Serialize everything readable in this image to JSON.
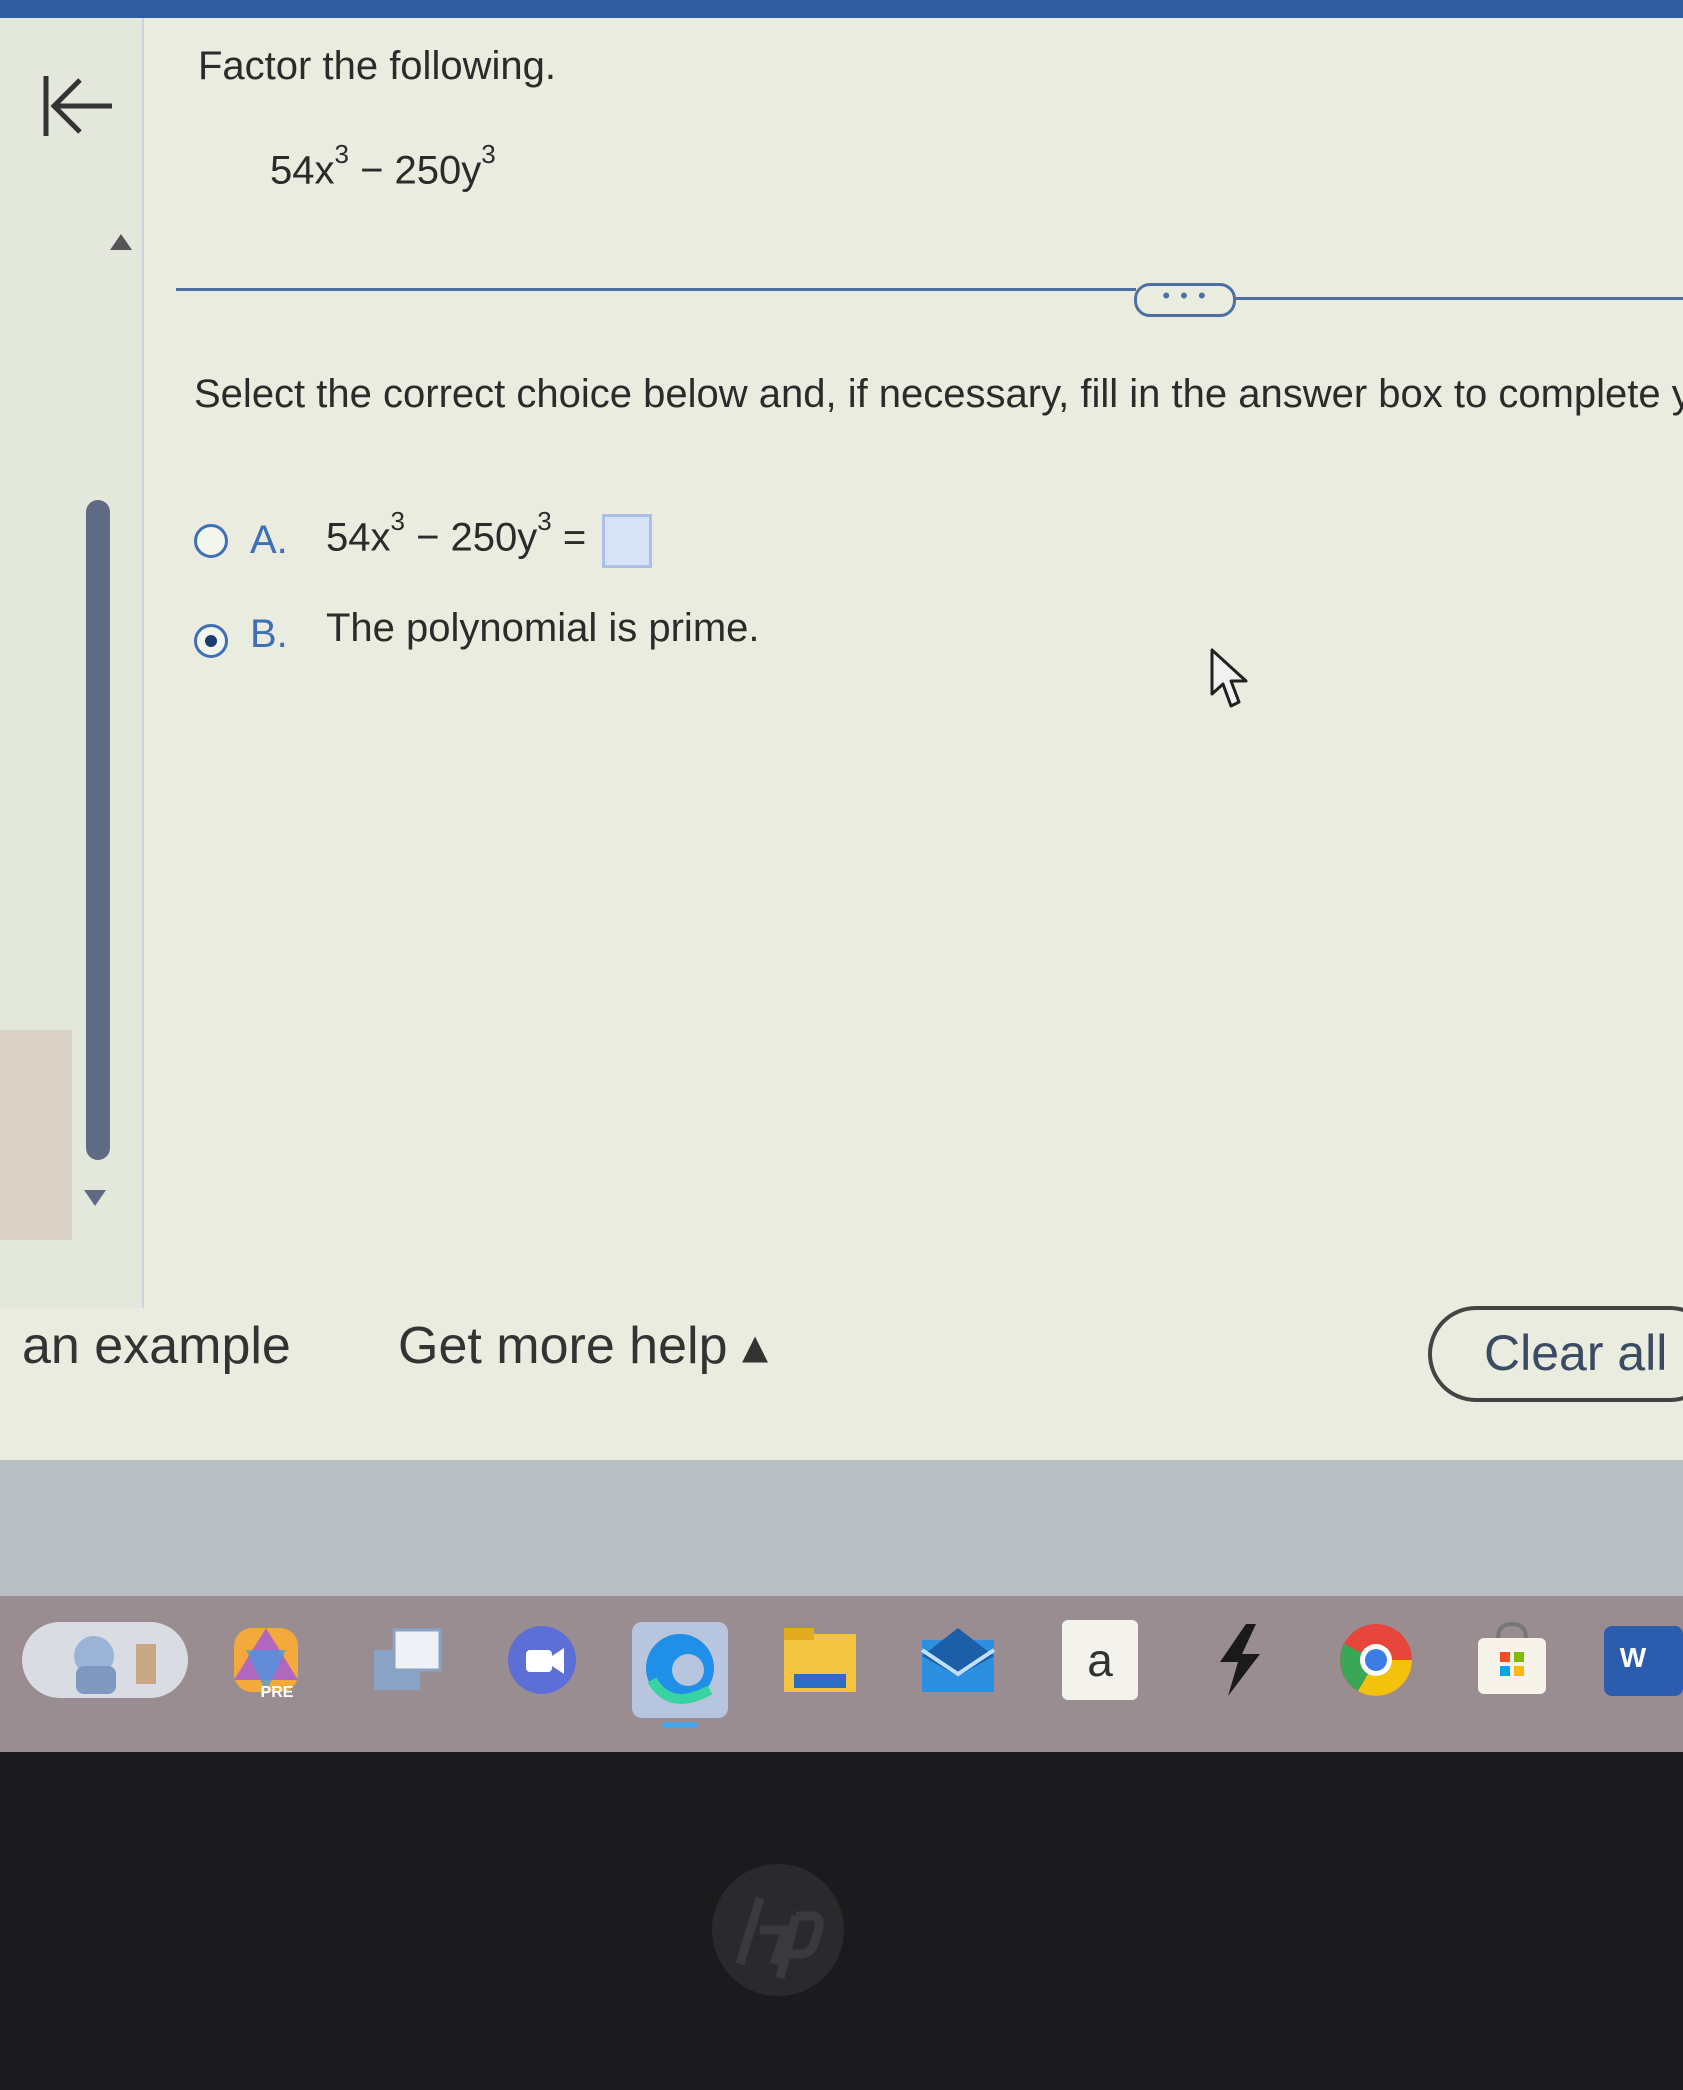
{
  "question": {
    "title": "Factor the following.",
    "expression": {
      "term1": "54x",
      "term1_exp": "3",
      "op": " − 250y",
      "term2_exp": "3"
    },
    "more_button": "• • •",
    "instruction": "Select the correct choice below and, if necessary, fill in the answer box to complete y"
  },
  "choices": {
    "a": {
      "letter": "A.",
      "term1": "54x",
      "term1_exp": "3",
      "term2": " − 250y",
      "term2_exp": "3",
      "equals": " =",
      "answer_value": "",
      "selected": false
    },
    "b": {
      "letter": "B.",
      "text": "The polynomial is prime.",
      "selected": true
    }
  },
  "footer": {
    "example_label": "an example",
    "help_label": "Get more help ▴",
    "clear_label": "Clear all"
  },
  "taskbar": {
    "items": [
      "widgets",
      "copilot",
      "task-view",
      "teams",
      "edge",
      "file-explorer",
      "mail",
      "amazon",
      "messenger",
      "chrome",
      "store",
      "word"
    ],
    "amazon_label": "a",
    "word_label": "W",
    "pre_label": "PRE"
  },
  "colors": {
    "accent": "#3f6fb5",
    "background": "#e9ecdf",
    "text": "#2b2b2b"
  }
}
